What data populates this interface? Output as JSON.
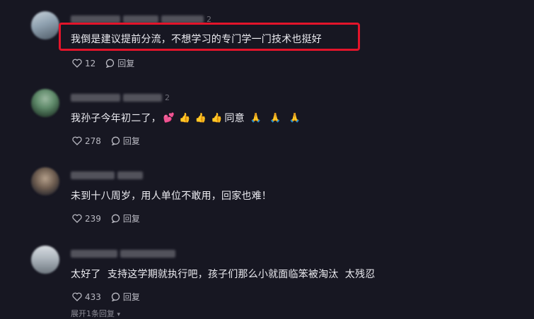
{
  "comments": [
    {
      "name_suffix": "2",
      "text": "我倒是建议提前分流，不想学习的专门学一门技术也挺好",
      "likes": "12",
      "reply_label": "回复"
    },
    {
      "name_suffix": "2",
      "text": "我孙子今年初二了，",
      "emoji_text": [
        "💕",
        "👍",
        "👍",
        "👍"
      ],
      "text_mid": "同意",
      "emoji_tail": [
        "🙏",
        "🙏",
        "🙏"
      ],
      "likes": "278",
      "reply_label": "回复"
    },
    {
      "name_suffix": "",
      "text": "未到十八周岁，用人单位不敢用，回家也难！",
      "likes": "239",
      "reply_label": "回复"
    },
    {
      "name_suffix": "",
      "text": "太好了  支持这学期就执行吧，孩子们那么小就面临笨被淘汰  太残忍",
      "likes": "433",
      "reply_label": "回复"
    }
  ],
  "expand_label": "展开1条回复",
  "colors": {
    "background": "#171722",
    "highlight": "#e3142a"
  }
}
